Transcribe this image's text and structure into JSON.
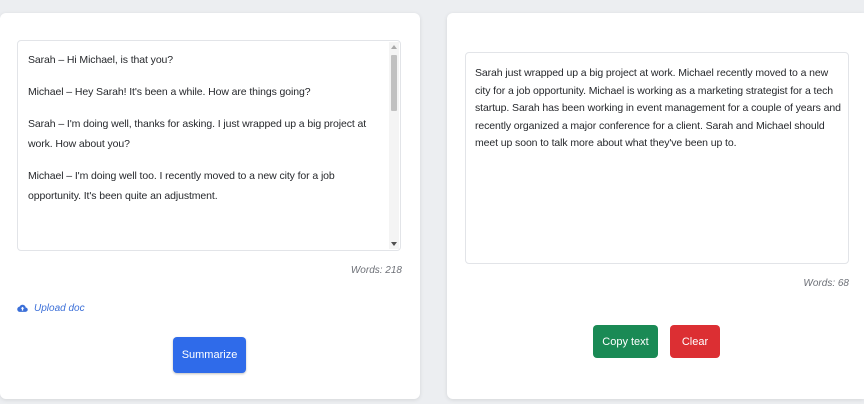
{
  "input": {
    "messages": [
      "Sarah – Hi Michael, is that you?",
      "Michael – Hey Sarah! It's been a while. How are things going?",
      "Sarah – I'm doing well, thanks for asking. I just wrapped up a big project at work. How about you?",
      "Michael – I'm doing well too. I recently moved to a new city for a job opportunity. It's been quite an adjustment."
    ],
    "word_count": "Words: 218",
    "scroll_position": 0.0
  },
  "upload": {
    "label": "Upload doc",
    "icon": "cloud-upload-icon"
  },
  "summarize_button": {
    "label": "Summarize"
  },
  "output": {
    "summary": "Sarah just wrapped up a big project at work. Michael recently moved to a new city for a job opportunity. Michael is working as a marketing strategist for a tech startup. Sarah has been working in event management for a couple of years and recently organized a major conference for a client. Sarah and Michael should meet up soon to talk more about what they've been up to.",
    "word_count": "Words: 68"
  },
  "actions": {
    "copy_label": "Copy text",
    "clear_label": "Clear"
  },
  "colors": {
    "primary": "#2f6bea",
    "success": "#1a8a55",
    "danger": "#dc2f33",
    "link": "#3b6fd8"
  }
}
